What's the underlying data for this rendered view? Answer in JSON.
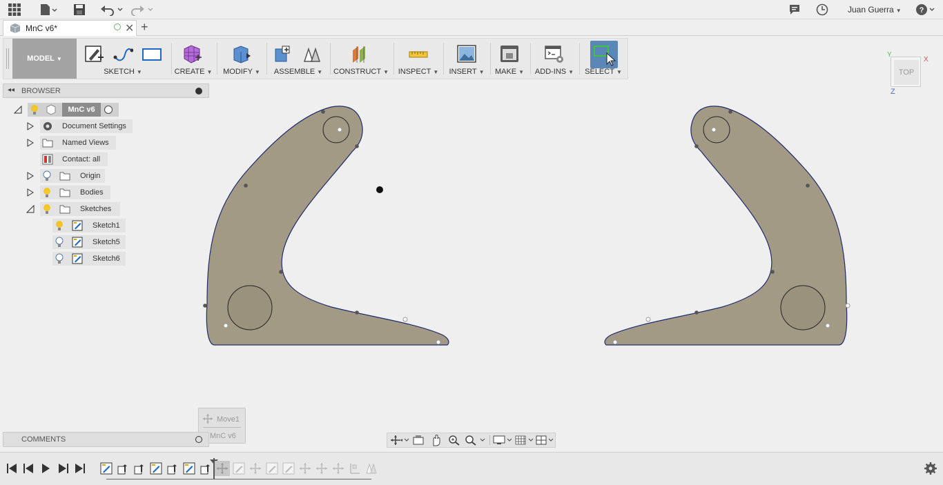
{
  "app": {
    "user": "Juan Guerra",
    "tab_title": "MnC v6*"
  },
  "toolbar": {
    "model_label": "MODEL",
    "groups": {
      "sketch": "SKETCH",
      "create": "CREATE",
      "modify": "MODIFY",
      "assemble": "ASSEMBLE",
      "construct": "CONSTRUCT",
      "inspect": "INSPECT",
      "insert": "INSERT",
      "make": "MAKE",
      "addins": "ADD-INS",
      "select": "SELECT"
    }
  },
  "browser": {
    "title": "BROWSER",
    "root": "MnC v6",
    "items": {
      "doc_settings": "Document Settings",
      "named_views": "Named Views",
      "contact": "Contact: all",
      "origin": "Origin",
      "bodies": "Bodies",
      "sketches": "Sketches",
      "sketch1": "Sketch1",
      "sketch5": "Sketch5",
      "sketch6": "Sketch6"
    }
  },
  "viewcube": {
    "face": "TOP",
    "axis_x": "X",
    "axis_y": "Y",
    "axis_z": "Z"
  },
  "comments": {
    "title": "COMMENTS"
  },
  "tooltip": {
    "feature": "Move1",
    "document": "MnC v6"
  },
  "colors": {
    "part_fill": "#a39a86",
    "part_edge": "#1f2a6b",
    "select_active": "#5b86b8",
    "tree_row": "#e3e3e3"
  }
}
